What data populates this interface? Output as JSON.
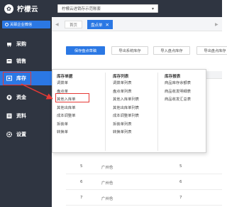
{
  "app": {
    "logo_glyph": "✿",
    "name": "柠檬云"
  },
  "header": {
    "store_select": {
      "value": "柠檬云进销存示范账套",
      "caret": "▾"
    }
  },
  "sidebar": {
    "wechat_label": "关联企业微信",
    "items": [
      {
        "label": "采购",
        "icon": "cart-icon"
      },
      {
        "label": "销售",
        "icon": "sales-icon"
      },
      {
        "label": "库存",
        "icon": "inventory-icon"
      },
      {
        "label": "资金",
        "icon": "money-icon"
      },
      {
        "label": "资料",
        "icon": "archive-icon"
      },
      {
        "label": "设置",
        "icon": "gear-icon"
      }
    ]
  },
  "tabs": {
    "prev": "◀",
    "next": "▶",
    "home": "首页",
    "active": "盘点单",
    "close": "✕"
  },
  "toolbar": {
    "save_draft": "保存盘点草稿",
    "export_system": "导出系统库存",
    "import_inventory": "导入盘点库存",
    "export_inventory": "导出盘点库存"
  },
  "table": {
    "rows": [
      {
        "num": "5",
        "warehouse": "广州仓",
        "qty": "5"
      },
      {
        "num": "6",
        "warehouse": "广州仓",
        "qty": "6"
      },
      {
        "num": "7",
        "warehouse": "广州仓",
        "qty": "7"
      }
    ]
  },
  "menu": {
    "col1": {
      "title": "库存单据",
      "items": [
        "调拨单",
        "盘点单",
        "其他入库单",
        "其他出库单",
        "成本调整单",
        "拆装单",
        "转换单"
      ]
    },
    "col2": {
      "title": "库存列表",
      "items": [
        "调拨单列表",
        "盘点单列表",
        "其他入库单列表",
        "其他出库单列表",
        "成本调整单列表",
        "拆装单列表",
        "转换单列表"
      ]
    },
    "col3": {
      "title": "库存报表",
      "items": [
        "商品库存余额表",
        "商品收发明细表",
        "商品收发汇总表"
      ]
    }
  },
  "colors": {
    "sidebar_bg": "#2f3541",
    "accent": "#2b78e4",
    "highlight": "#e53935"
  }
}
